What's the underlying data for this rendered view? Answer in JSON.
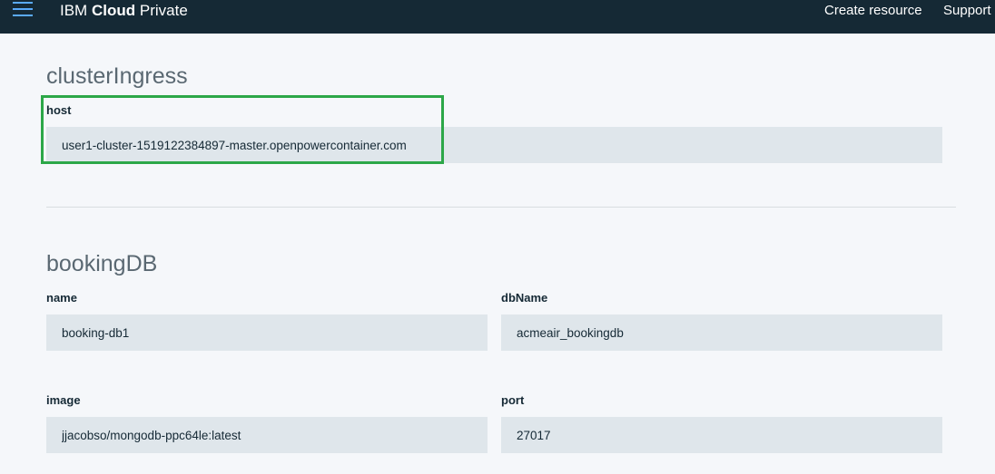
{
  "app": {
    "title_prefix": "IBM",
    "title_bold": "Cloud",
    "title_suffix": "Private"
  },
  "topnav": {
    "create_resource": "Create resource",
    "support": "Support"
  },
  "sections": {
    "clusterIngress": {
      "title": "clusterIngress",
      "host_label": "host",
      "host_value": "user1-cluster-1519122384897-master.openpowercontainer.com"
    },
    "bookingDB": {
      "title": "bookingDB",
      "name_label": "name",
      "name_value": "booking-db1",
      "dbName_label": "dbName",
      "dbName_value": "acmeair_bookingdb",
      "image_label": "image",
      "image_value": "jjacobso/mongodb-ppc64le:latest",
      "port_label": "port",
      "port_value": "27017"
    }
  },
  "colors": {
    "topbar": "#152935",
    "hamburger": "#5aaafa",
    "page_background": "#f5f7fa",
    "input_background": "#dfe6eb",
    "highlight": "#2ca748"
  },
  "icons": {
    "menu": "hamburger-menu-icon"
  }
}
